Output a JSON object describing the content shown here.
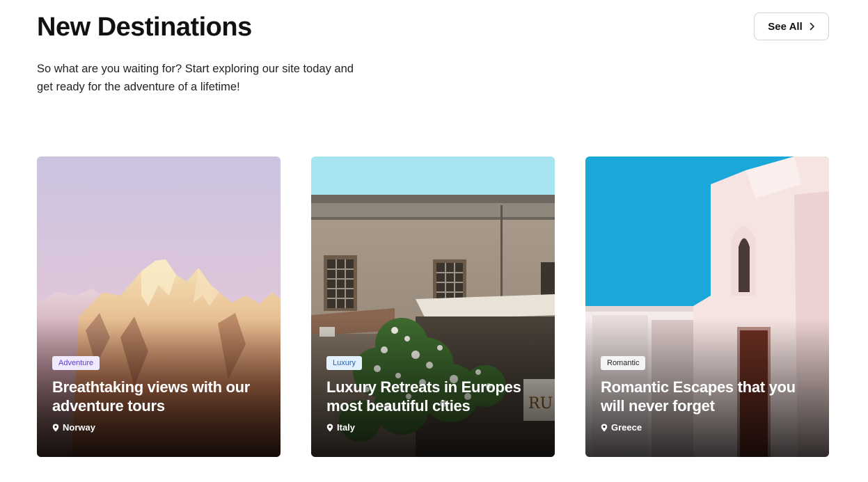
{
  "section": {
    "title": "New Destinations",
    "subtitle": "So what are you waiting for? Start exploring our site today and get ready for the adventure of a lifetime!",
    "see_all_label": "See All"
  },
  "icons": {
    "see_all": "chevron-right-icon",
    "location": "map-pin-icon"
  },
  "cards": [
    {
      "tag": "Adventure",
      "title": "Breathtaking views with our adventure tours",
      "location": "Norway",
      "image": "snowy-mountain-peaks-photo"
    },
    {
      "tag": "Luxury",
      "title": "Luxury Retreats in Europes most beautiful cities",
      "location": "Italy",
      "image": "old-european-building-photo"
    },
    {
      "tag": "Romantic",
      "title": "Romantic Escapes that you will never forget",
      "location": "Greece",
      "image": "white-greek-church-photo"
    }
  ],
  "colors": {
    "adventure_tag_bg": "#efeafd",
    "adventure_tag_text": "#5b3fc7",
    "luxury_tag_bg": "#e3f1ff",
    "luxury_tag_text": "#1f5fb0",
    "romantic_tag_bg": "#f4f4f4",
    "romantic_tag_text": "#222222"
  }
}
